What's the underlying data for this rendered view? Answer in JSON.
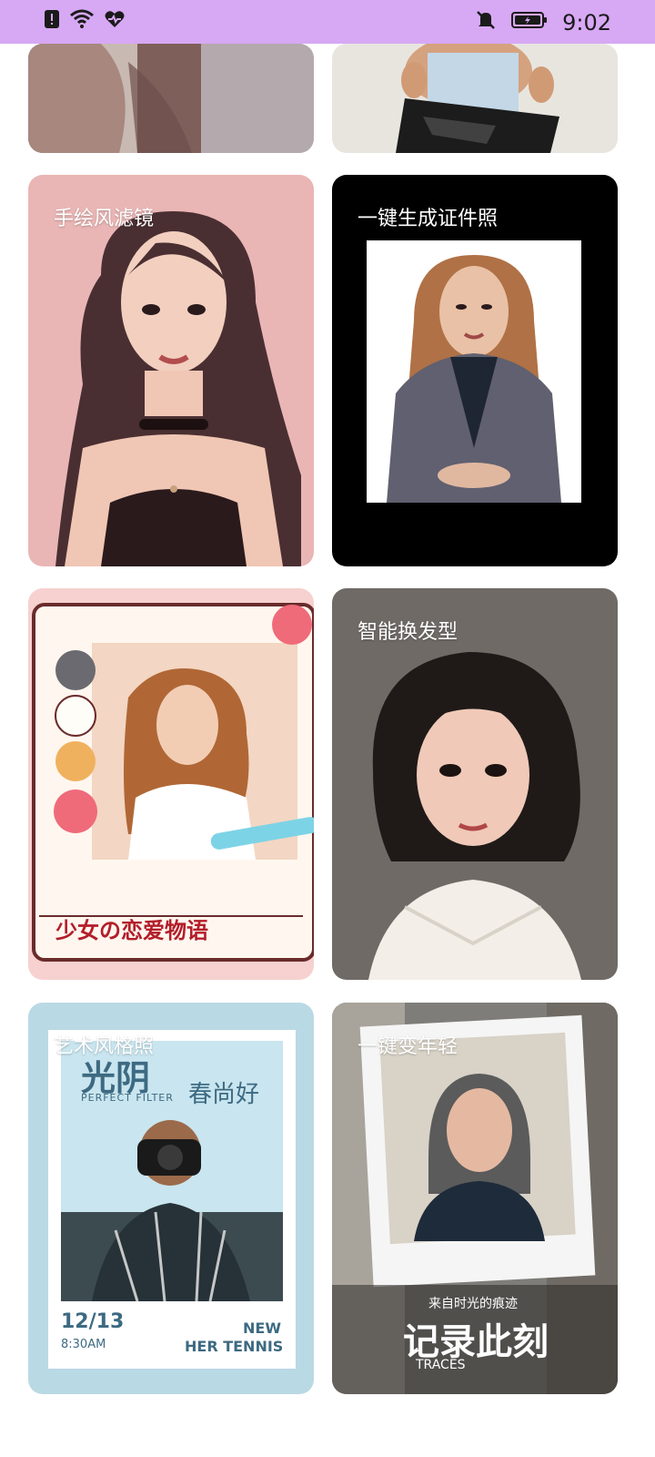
{
  "status_bar": {
    "time": "9:02",
    "icons": [
      "alert-icon",
      "wifi-icon",
      "heart-rate-icon",
      "mute-icon",
      "battery-icon"
    ]
  },
  "cards": [
    {
      "id": "top-left",
      "title": ""
    },
    {
      "id": "top-right",
      "title": ""
    },
    {
      "id": "hand-drawn",
      "title": "手绘风滤镜"
    },
    {
      "id": "id-photo",
      "title": "一键生成证件照"
    },
    {
      "id": "girl-story",
      "title": "",
      "overlay": "少女の恋爱物语"
    },
    {
      "id": "hair-change",
      "title": "智能换发型"
    },
    {
      "id": "art-style",
      "title": "艺术风格照",
      "poster": {
        "brand": "光阴",
        "sub": "PERFECT FILTER",
        "slogan": "春尚好",
        "date": "12/13",
        "time": "8:30AM",
        "new": "NEW",
        "tag": "HER TENNIS"
      }
    },
    {
      "id": "age-change",
      "title": "一键变年轻",
      "poster": {
        "top": "来自时光的痕迹",
        "main": "记录此刻",
        "sub": "TRACES"
      }
    }
  ],
  "colors": {
    "status_bar": "#d7a8f4",
    "card_pink": "#e9b6b5",
    "card_black": "#000000",
    "card_gray": "#6f6a66"
  }
}
